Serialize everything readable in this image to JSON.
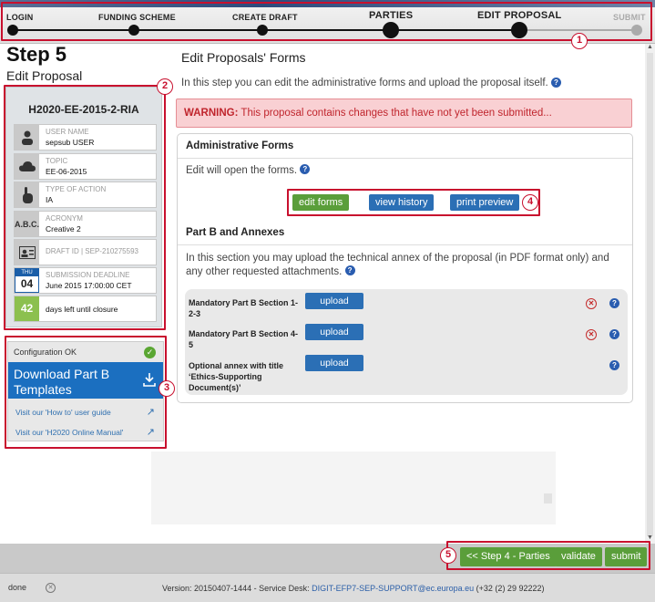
{
  "progress": {
    "steps": [
      {
        "label": "LOGIN"
      },
      {
        "label": "FUNDING SCHEME"
      },
      {
        "label": "CREATE DRAFT"
      },
      {
        "label": "PARTIES"
      },
      {
        "label": "EDIT PROPOSAL"
      },
      {
        "label": "SUBMIT"
      }
    ]
  },
  "markers": [
    "1",
    "2",
    "3",
    "4",
    "5"
  ],
  "left": {
    "step_title": "Step 5",
    "step_subtitle": "Edit Proposal",
    "proposal_code": "H2020-EE-2015-2-RIA",
    "rows": [
      {
        "label": "USER NAME",
        "value": "sepsub USER"
      },
      {
        "label": "TOPIC",
        "value": "EE-06-2015"
      },
      {
        "label": "TYPE OF ACTION",
        "value": "IA"
      },
      {
        "label": "ACRONYM",
        "value": "Creative 2"
      },
      {
        "label": "DRAFT ID | SEP-210275593",
        "value": ""
      },
      {
        "label": "SUBMISSION DEADLINE",
        "value": "June 2015 17:00:00 CET"
      },
      {
        "label": "",
        "value": "days left until closure"
      }
    ],
    "acronym_icon_text": "A.B.C.",
    "calendar": {
      "day_name": "THU",
      "day": "04"
    },
    "days_left": "42",
    "config": {
      "status": "Configuration OK",
      "download_label": "Download Part B Templates",
      "links": [
        "Visit our 'How to' user guide",
        "Visit our 'H2020 Online Manual'"
      ]
    }
  },
  "main": {
    "title": "Edit Proposals' Forms",
    "intro": "In this step you can edit the administrative forms and upload the proposal itself.",
    "warning_label": "WARNING:",
    "warning_text": "This proposal contains changes that have not yet been submitted...",
    "admin": {
      "title": "Administrative Forms",
      "text": "Edit will open the forms.",
      "buttons": [
        "edit forms",
        "view history",
        "print preview"
      ]
    },
    "partb": {
      "title": "Part B and Annexes",
      "text": "In this section you may upload the technical annex of the proposal (in PDF format only) and any other requested attachments.",
      "uploads": [
        {
          "label": "Mandatory Part B Section 1-2-3",
          "button": "upload"
        },
        {
          "label": "Mandatory Part B Section 4-5",
          "button": "upload"
        },
        {
          "label": "Optional annex with title ‘Ethics-Supporting Document(s)’",
          "button": "upload"
        }
      ]
    }
  },
  "footer": {
    "buttons": [
      "<< Step 4 - Parties",
      "validate",
      "submit"
    ],
    "status": "done",
    "version_text": "Version: 20150407-1444 - Service Desk:",
    "email": "DIGIT-EFP7-SEP-SUPPORT@ec.europa.eu",
    "phone": "(+32 (2) 29 92222)"
  },
  "colors": {
    "accent": "#c8102e",
    "green": "#5a9e3a",
    "blue": "#2b6fb5"
  }
}
